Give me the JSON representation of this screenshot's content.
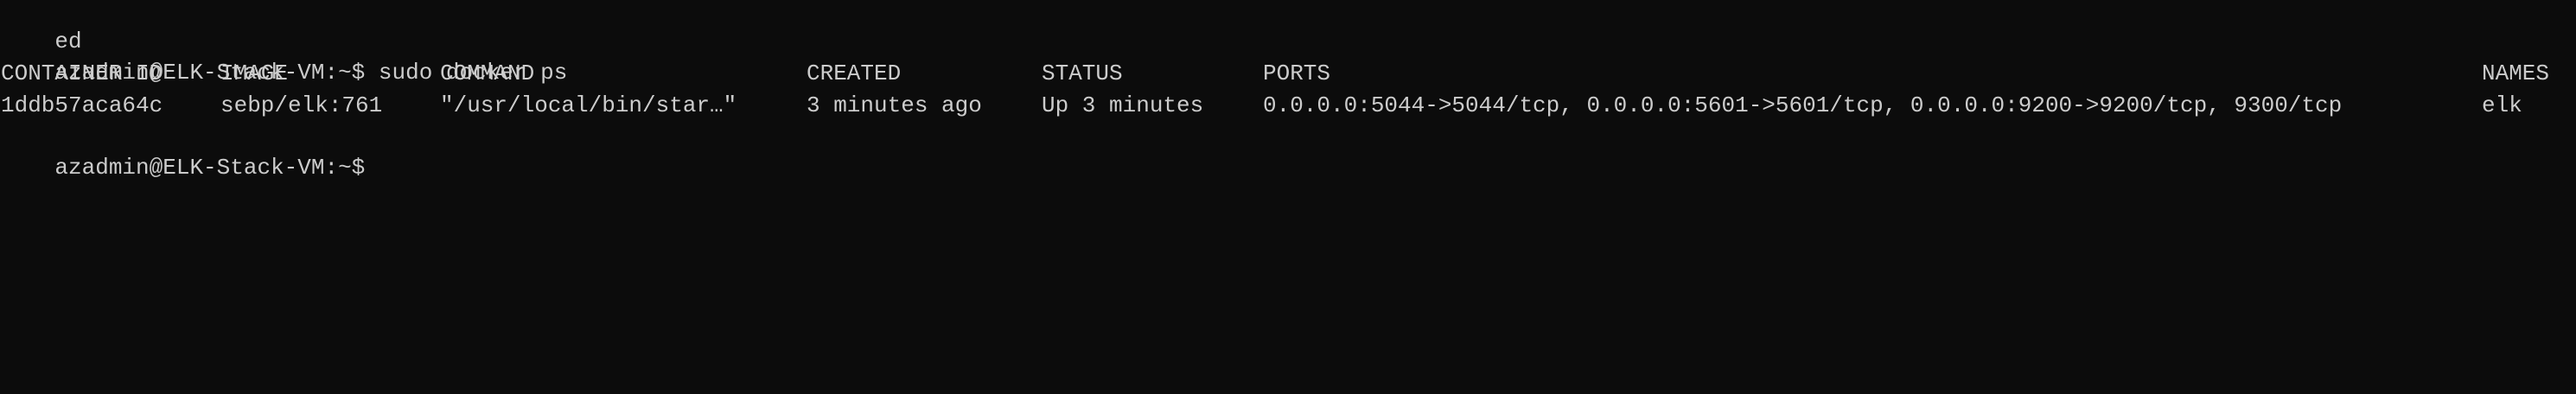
{
  "terminal": {
    "lines": {
      "prev_output": "ed",
      "prompt_1": "azadmin@ELK-Stack-VM:~$ sudo docker ps",
      "prompt_2": "azadmin@ELK-Stack-VM:~$"
    },
    "table": {
      "headers": {
        "container_id": "CONTAINER ID",
        "image": "IMAGE",
        "command": "COMMAND",
        "created": "CREATED",
        "status": "STATUS",
        "ports": "PORTS",
        "names": "NAMES"
      },
      "rows": [
        {
          "container_id": "1ddb57aca64c",
          "image": "sebp/elk:761",
          "command": "\"/usr/local/bin/star…\"",
          "created": "3 minutes ago",
          "status": "Up 3 minutes",
          "ports": "0.0.0.0:5044->5044/tcp, 0.0.0.0:5601->5601/tcp, 0.0.0.0:9200->9200/tcp, 9300/tcp",
          "names": "elk"
        }
      ]
    }
  },
  "colors": {
    "background": "#0c0c0c",
    "foreground": "#cccccc"
  }
}
